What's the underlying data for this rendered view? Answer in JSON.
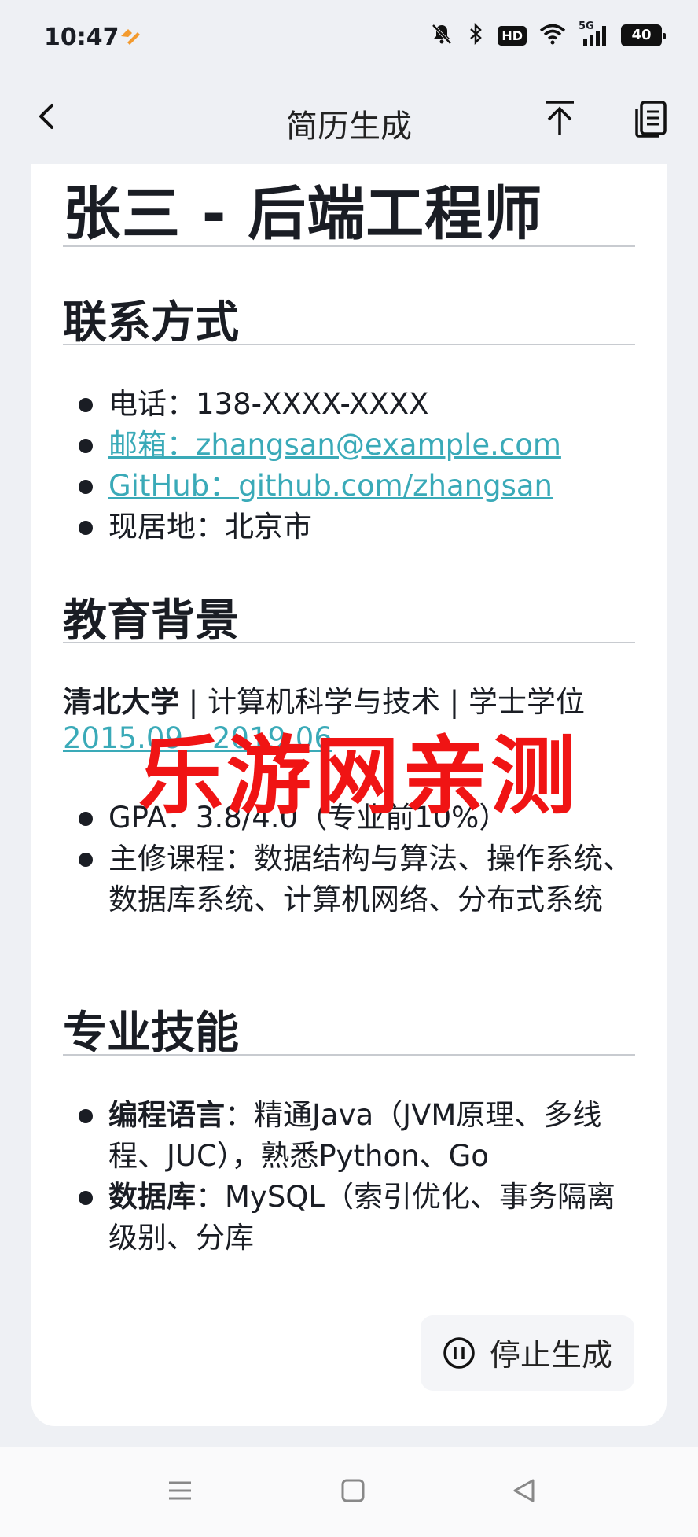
{
  "status_bar": {
    "time": "10:47",
    "network": "5G",
    "hd": "HD",
    "battery": "40"
  },
  "app_bar": {
    "title": "简历生成"
  },
  "resume": {
    "heading": "张三 - 后端工程师",
    "contact": {
      "title": "联系方式",
      "items": [
        "电话：138-XXXX-XXXX",
        "邮箱：zhangsan@example.com",
        "GitHub：github.com/zhangsan",
        "现居地：北京市"
      ]
    },
    "education": {
      "title": "教育背景",
      "school": "清北大学",
      "major_degree": " | 计算机科学与技术 | 学士学位",
      "period": "2015.09 - 2019.06",
      "items": [
        "GPA：3.8/4.0（专业前10%）",
        "主修课程：数据结构与算法、操作系统、数据库系统、计算机网络、分布式系统"
      ]
    },
    "skills": {
      "title": "专业技能",
      "items": [
        {
          "label": "编程语言",
          "text": "：精通Java（JVM原理、多线程、JUC），熟悉Python、Go"
        },
        {
          "label": "数据库",
          "text": "：MySQL（索引优化、事务隔离级别、分库"
        }
      ]
    }
  },
  "watermark": "乐游网亲测",
  "stop_button": {
    "label": "停止生成"
  },
  "colors": {
    "link": "#3aaab8",
    "watermark": "#f01414",
    "background": "#eef0f4"
  },
  "icons": [
    "back-arrow-icon",
    "scroll-to-top-icon",
    "copy-document-icon",
    "pause-icon",
    "menu-icon",
    "home-icon",
    "back-triangle-icon"
  ]
}
